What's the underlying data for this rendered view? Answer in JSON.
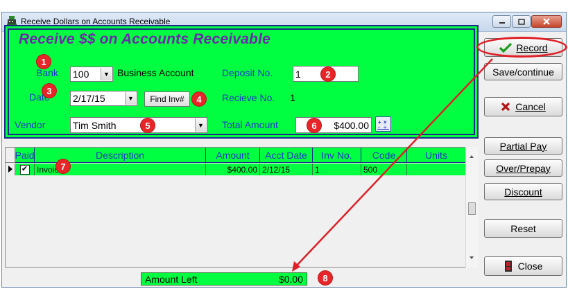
{
  "window": {
    "title": "Receive Dollars on Accounts Receivable",
    "app_icon": "cash-register-icon"
  },
  "title_buttons": [
    "minimize-icon",
    "maximize-icon",
    "close-icon"
  ],
  "form": {
    "heading": "Receive $$ on Accounts Receivable",
    "bank_label": "Bank",
    "bank_value": "100",
    "bank_name": "Business Account",
    "deposit_label": "Deposit No.",
    "deposit_value": "1",
    "date_label": "Date",
    "date_value": "2/17/15",
    "find_inv_label": "Find Inv#",
    "receive_label": "Recieve No.",
    "receive_value": "1",
    "vendor_label": "Vendor",
    "vendor_value": "Tim Smith",
    "total_label": "Total Amount",
    "total_value": "$400.00",
    "calculator_icon": "calculator-icon"
  },
  "badges": [
    "1",
    "2",
    "3",
    "4",
    "5",
    "6",
    "7",
    "8"
  ],
  "grid": {
    "columns": [
      "Paid",
      "Description",
      "Amount",
      "Acct Date",
      "Inv No.",
      "Code",
      "Units"
    ],
    "rows": [
      {
        "paid": true,
        "description": "Invoice",
        "amount": "$400.00",
        "acct_date": "2/12/15",
        "inv_no": "1",
        "code": "500",
        "units": ""
      }
    ]
  },
  "amount_left": {
    "label": "Amount Left",
    "value": "$0.00"
  },
  "side_buttons": {
    "record": "Record",
    "save_continue": "Save/continue",
    "cancel": "Cancel",
    "partial_pay": "Partial Pay",
    "over_prepay": "Over/Prepay",
    "discount": "Discount",
    "reset": "Reset",
    "close": "Close"
  },
  "colors": {
    "panel_green": "#00ff41",
    "label_blue": "#1b34c9",
    "heading_purple": "#6c2aa8",
    "annotation_red": "#e01e26"
  }
}
